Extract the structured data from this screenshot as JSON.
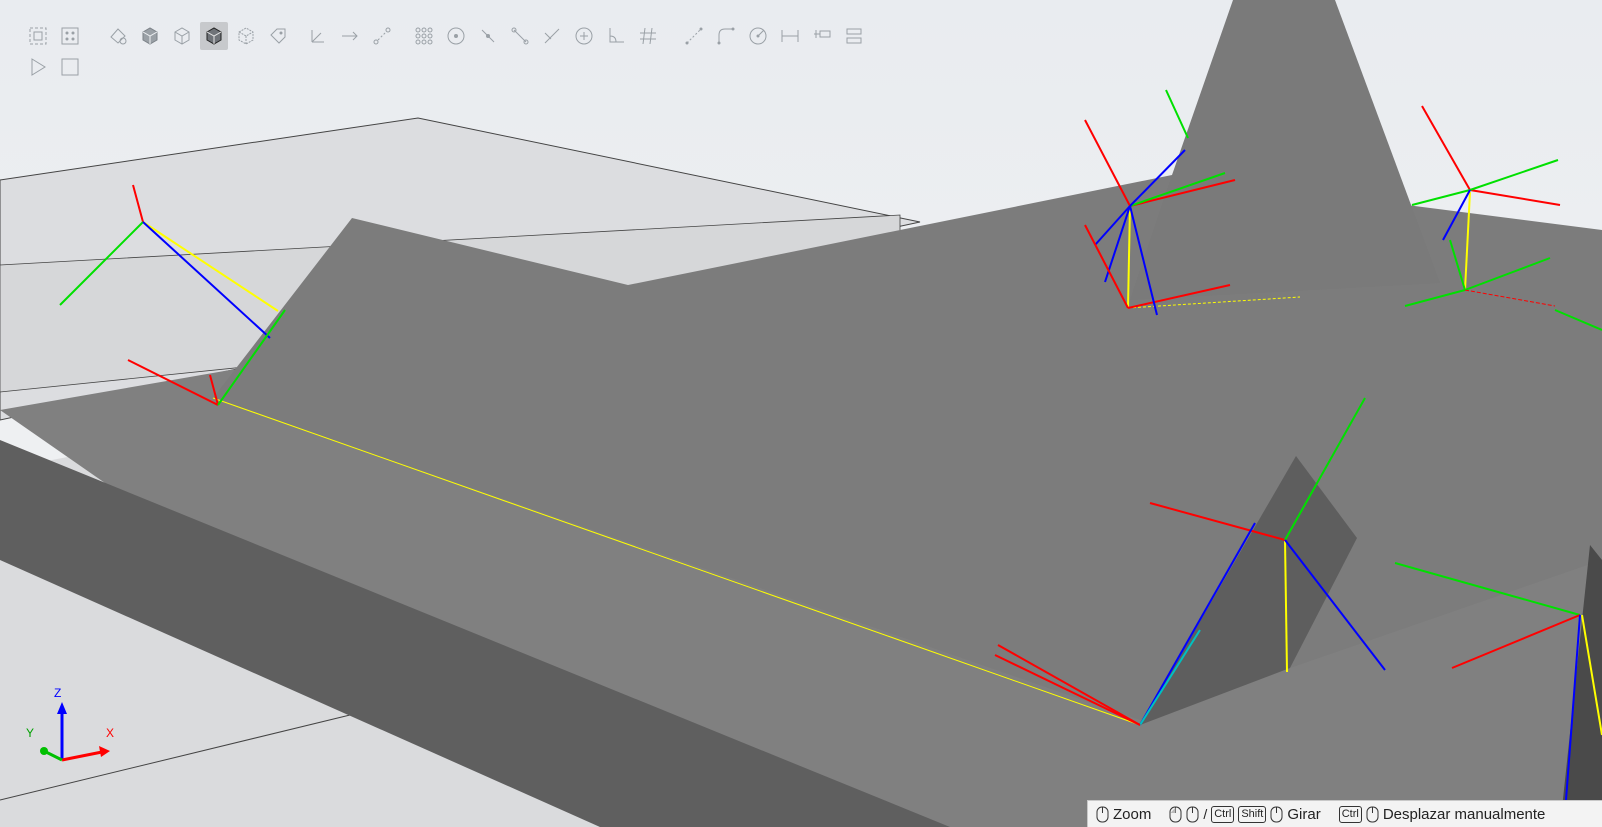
{
  "toolbar": {
    "row1": [
      {
        "icon": "fit-all-icon",
        "active": false
      },
      {
        "icon": "fit-selection-icon",
        "active": false
      },
      {
        "icon": "render-style-icon",
        "active": false
      },
      {
        "icon": "shaded-cube-icon",
        "active": false
      },
      {
        "icon": "wireframe-cube-icon",
        "active": false
      },
      {
        "icon": "shaded-edges-cube-icon",
        "active": true
      },
      {
        "icon": "hidden-line-cube-icon",
        "active": false
      },
      {
        "icon": "tag-icon",
        "active": false
      },
      {
        "icon": "frame-axes-icon",
        "active": false
      },
      {
        "icon": "direction-arrow-icon",
        "active": false
      },
      {
        "icon": "path-points-icon",
        "active": false
      },
      {
        "icon": "grid-dots-icon",
        "active": false
      },
      {
        "icon": "target-icon",
        "active": false
      },
      {
        "icon": "point-line-icon",
        "active": false
      },
      {
        "icon": "segment-icon",
        "active": false
      },
      {
        "icon": "cross-icon",
        "active": false
      },
      {
        "icon": "circle-center-icon",
        "active": false
      },
      {
        "icon": "angle-icon",
        "active": false
      },
      {
        "icon": "grid-hash-icon",
        "active": false
      },
      {
        "icon": "measure-distance-icon",
        "active": false
      },
      {
        "icon": "measure-arc-icon",
        "active": false
      },
      {
        "icon": "measure-radius-icon",
        "active": false
      },
      {
        "icon": "dimension-icon",
        "active": false
      },
      {
        "icon": "clearance-icon",
        "active": false
      },
      {
        "icon": "align-icon",
        "active": false
      }
    ],
    "row2": [
      {
        "icon": "play-icon",
        "active": false
      },
      {
        "icon": "stop-icon",
        "active": false
      }
    ]
  },
  "axis_triad": {
    "x_label": "X",
    "y_label": "Y",
    "z_label": "Z"
  },
  "statusbar": {
    "zoom_label": "Zoom",
    "separator": "/",
    "ctrl_key": "Ctrl",
    "shift_key": "Shift",
    "rotate_label": "Girar",
    "ctrl_key_2": "Ctrl",
    "pan_label": "Desplazar manualmente"
  },
  "colors": {
    "background": "#eef0f3",
    "floor": "#d2d3d5",
    "part_top": "#808080",
    "part_side": "#5e5e5e",
    "axis_x": "#ff0000",
    "axis_y": "#00e000",
    "axis_z": "#0000ff",
    "path": "#ffff00"
  }
}
